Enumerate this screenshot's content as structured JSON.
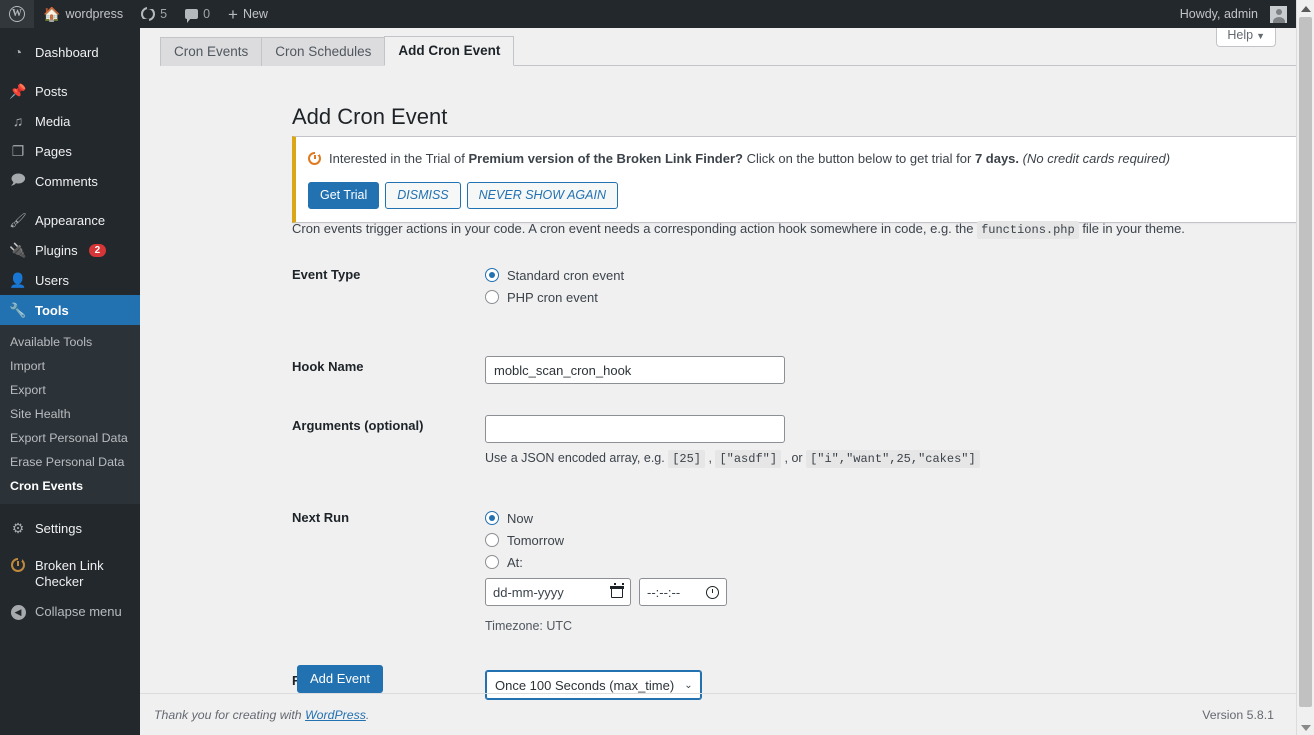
{
  "adminbar": {
    "logo_icon": "wordpress-logo-icon",
    "site_name": "wordpress",
    "home_icon": "home-icon",
    "updates_icon": "updates-icon",
    "updates_count": "5",
    "comments_icon": "comment-bubble-icon",
    "comments_count": "0",
    "new_icon": "plus-icon",
    "new_label": "New",
    "howdy": "Howdy, admin",
    "avatar_icon": "avatar-icon"
  },
  "sidebar": {
    "items": [
      {
        "label": "Dashboard",
        "icon": "dashboard-icon",
        "glyph": "◉"
      },
      {
        "label": "Posts",
        "icon": "pin-icon",
        "glyph": "✇"
      },
      {
        "label": "Media",
        "icon": "media-icon",
        "glyph": "♫"
      },
      {
        "label": "Pages",
        "icon": "pages-icon",
        "glyph": "❐"
      },
      {
        "label": "Comments",
        "icon": "comments-icon",
        "glyph": "🗩"
      },
      {
        "label": "Appearance",
        "icon": "brush-icon",
        "glyph": "✎"
      },
      {
        "label": "Plugins",
        "icon": "plug-icon",
        "glyph": "⚲",
        "badge": "2"
      },
      {
        "label": "Users",
        "icon": "users-icon",
        "glyph": "☻"
      },
      {
        "label": "Tools",
        "icon": "wrench-icon",
        "glyph": "🔧",
        "current": true
      },
      {
        "label": "Settings",
        "icon": "settings-icon",
        "glyph": "⚙"
      },
      {
        "label": "Broken Link Checker",
        "icon": "broken-link-checker-icon"
      }
    ],
    "submenu": [
      {
        "label": "Available Tools"
      },
      {
        "label": "Import"
      },
      {
        "label": "Export"
      },
      {
        "label": "Site Health"
      },
      {
        "label": "Export Personal Data"
      },
      {
        "label": "Erase Personal Data"
      },
      {
        "label": "Cron Events",
        "current": true
      }
    ],
    "collapse_label": "Collapse menu",
    "collapse_icon": "collapse-arrow-icon"
  },
  "help_tab": {
    "label": "Help",
    "caret": "▼"
  },
  "tabs": [
    {
      "label": "Cron Events",
      "active": false
    },
    {
      "label": "Cron Schedules",
      "active": false
    },
    {
      "label": "Add Cron Event",
      "active": true
    }
  ],
  "page_title": "Add Cron Event",
  "notice": {
    "icon": "broken-link-checker-icon",
    "text_1": "Interested in the Trial of ",
    "text_bold_1": "Premium version of the Broken Link Finder?",
    "text_2": " Click on the button below to get trial for ",
    "text_bold_2": "7 days.",
    "text_italic": " (No credit cards required)",
    "buttons": {
      "get_trial": "Get Trial",
      "dismiss": "DISMISS",
      "never_show": "NEVER SHOW AGAIN"
    },
    "close_icon": "close-icon",
    "close_glyph": "✕",
    "accent_color": "#dba617"
  },
  "description": {
    "part_1": "Cron events trigger actions in your code. A cron event needs a corresponding action hook somewhere in code, e.g. the ",
    "code": "functions.php",
    "part_2": " file in your theme."
  },
  "form": {
    "event_type": {
      "label": "Event Type",
      "options": [
        {
          "label": "Standard cron event",
          "checked": true
        },
        {
          "label": "PHP cron event",
          "checked": false
        }
      ]
    },
    "hook_name": {
      "label": "Hook Name",
      "value": "moblc_scan_cron_hook",
      "placeholder": ""
    },
    "arguments": {
      "label": "Arguments (optional)",
      "value": "",
      "placeholder": "",
      "help_part_1": "Use a JSON encoded array, e.g. ",
      "help_code_1": "[25]",
      "help_part_2": " , ",
      "help_code_2": "[\"asdf\"]",
      "help_part_3": " , or ",
      "help_code_3": "[\"i\",\"want\",25,\"cakes\"]"
    },
    "next_run": {
      "label": "Next Run",
      "options": [
        {
          "label": "Now",
          "checked": true
        },
        {
          "label": "Tomorrow",
          "checked": false
        },
        {
          "label": "At:",
          "checked": false
        }
      ],
      "date_placeholder": "dd-mm-yyyy",
      "date_icon": "calendar-icon",
      "time_placeholder": "--:--:--",
      "time_icon": "clock-icon",
      "timezone": "Timezone: UTC"
    },
    "recurrence": {
      "label": "Recurrence",
      "selected": "Once 100 Seconds (max_time)",
      "caret": "⌄"
    },
    "submit_label": "Add Event"
  },
  "footer": {
    "thanks_prefix": "Thank you for creating with ",
    "link": "WordPress",
    "thanks_suffix": ".",
    "version": "Version 5.8.1"
  }
}
